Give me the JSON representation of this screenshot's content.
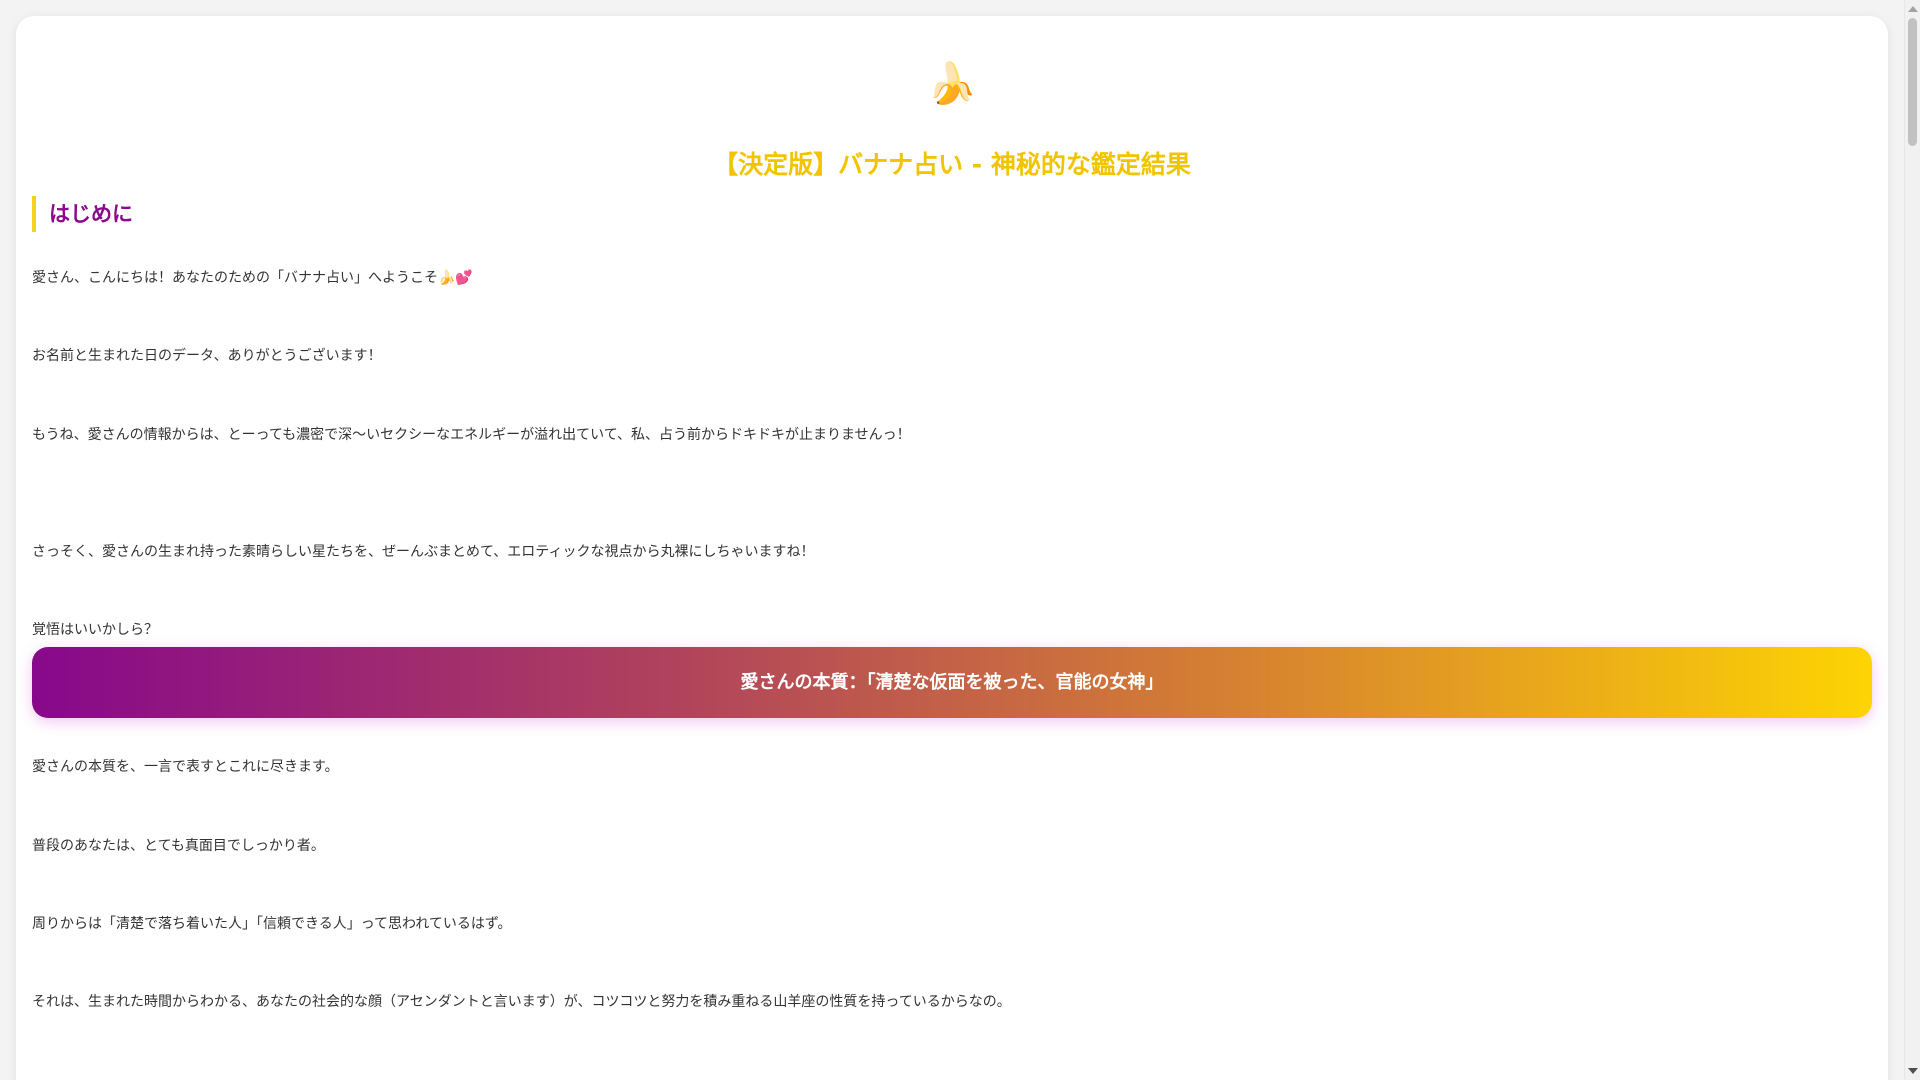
{
  "header": {
    "banana_emoji": "🍌",
    "title": "【決定版】バナナ占い - 神秘的な鑑定結果"
  },
  "intro": {
    "heading": "はじめに",
    "paragraphs": [
      "愛さん、こんにちは！あなたのための「バナナ占い」へようこそ🍌💕",
      "お名前と生まれた日のデータ、ありがとうございます！",
      "もうね、愛さんの情報からは、とーっても濃密で深〜いセクシーなエネルギーが溢れ出ていて、私、占う前からドキドキが止まりませんっ！",
      "さっそく、愛さんの生まれ持った素晴らしい星たちを、ぜーんぶまとめて、エロティックな視点から丸裸にしちゃいますね！",
      "覚悟はいいかしら？"
    ]
  },
  "essence": {
    "banner": "愛さんの本質：「清楚な仮面を被った、官能の女神」",
    "paragraphs": [
      "愛さんの本質を、一言で表すとこれに尽きます。",
      "普段のあなたは、とても真面目でしっかり者。",
      "周りからは「清楚で落ち着いた人」「信頼できる人」って思われているはず。",
      "それは、生まれた時間からわかる、あなたの社会的な顔（アセンダントと言います）が、コツコツと努力を積み重ねる山羊座の性質を持っているからなの。"
    ]
  },
  "colors": {
    "title": "#f2c400",
    "heading": "#8b0a8b",
    "heading_bar": "#f7d21c",
    "banner_gradient": [
      "#88088b",
      "#fdd403"
    ]
  }
}
